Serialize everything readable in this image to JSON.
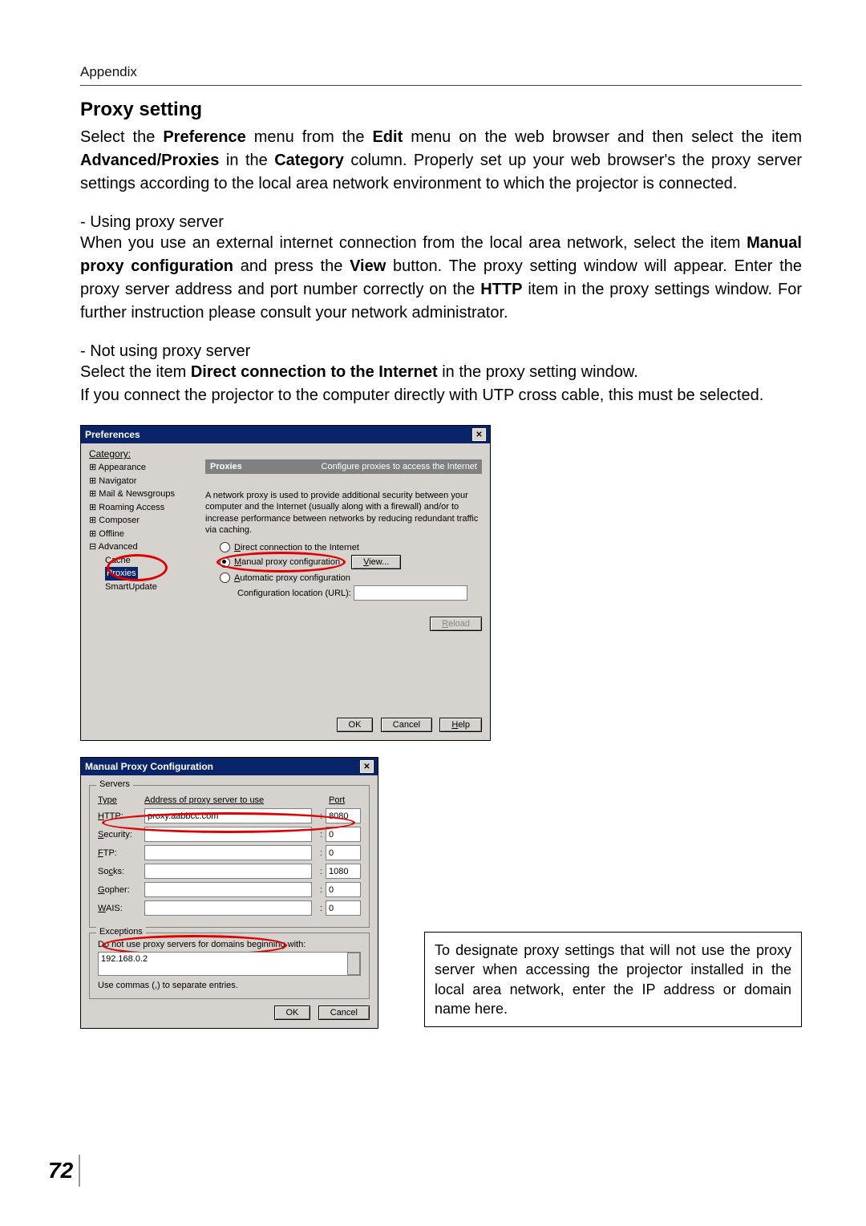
{
  "header": "Appendix",
  "title": "Proxy setting",
  "para1": {
    "pre": "Select the ",
    "bold1": "Preference",
    "mid1": " menu from the ",
    "bold2": "Edit",
    "mid2": " menu on the web browser and then select the item ",
    "bold3": "Advanced/Proxies",
    "mid3": " in the ",
    "bold4": "Category",
    "post": " column. Properly set up your web browser's the proxy server settings according to the local area network environment to which the projector is connected."
  },
  "sub1": "- Using proxy server",
  "para2": {
    "pre": "When you use an external internet connection from the local area network, select the item ",
    "bold1": "Manual proxy configuration",
    "mid1": " and press the ",
    "bold2": "View",
    "mid2": " button. The proxy setting window will appear. Enter the proxy server address and port number correctly on the ",
    "bold3": "HTTP",
    "post": " item in the proxy settings window. For further instruction please consult your network administrator."
  },
  "sub2": "- Not using proxy server",
  "para3": {
    "pre": "Select the item ",
    "bold1": "Direct connection to the Internet",
    "post": " in the proxy setting window."
  },
  "para4": "If you connect the projector to the computer directly with UTP cross cable, this must be selected.",
  "prefs": {
    "title": "Preferences",
    "category_label": "Category:",
    "tree": {
      "appearance": "Appearance",
      "navigator": "Navigator",
      "mail": "Mail & Newsgroups",
      "roaming": "Roaming Access",
      "composer": "Composer",
      "offline": "Offline",
      "advanced": "Advanced",
      "cache": "Cache",
      "proxies": "Proxies",
      "smart": "SmartUpdate"
    },
    "pane_title_left": "Proxies",
    "pane_title_right": "Configure proxies to access the Internet",
    "desc": "A network proxy is used to provide additional security between your computer and the Internet (usually along with a firewall) and/or to increase performance between networks by reducing redundant traffic via caching.",
    "radio_direct": "Direct connection to the Internet",
    "radio_manual": "Manual proxy configuration",
    "btn_view": "View...",
    "radio_auto": "Automatic proxy configuration",
    "url_label": "Configuration location (URL):",
    "btn_reload": "Reload",
    "btn_ok": "OK",
    "btn_cancel": "Cancel",
    "btn_help": "Help"
  },
  "manual": {
    "title": "Manual Proxy Configuration",
    "servers_label": "Servers",
    "type_label": "Type",
    "addr_label": "Address of proxy server to use",
    "port_label": "Port",
    "rows": [
      {
        "label": "HTTP:",
        "addr": "proxy.aabbcc.com",
        "port": "8080"
      },
      {
        "label": "Security:",
        "addr": "",
        "port": "0"
      },
      {
        "label": "FTP:",
        "addr": "",
        "port": "0"
      },
      {
        "label": "Socks:",
        "addr": "",
        "port": "1080"
      },
      {
        "label": "Gopher:",
        "addr": "",
        "port": "0"
      },
      {
        "label": "WAIS:",
        "addr": "",
        "port": "0"
      }
    ],
    "exceptions_label": "Exceptions",
    "exceptions_desc": "Do not use proxy servers for domains beginning with:",
    "exceptions_value": "192.168.0.2",
    "exceptions_hint": "Use commas (,) to separate entries.",
    "btn_ok": "OK",
    "btn_cancel": "Cancel"
  },
  "note": "To designate proxy settings that will not use the proxy server when accessing the projector installed in the local area network, enter the IP address or domain name here.",
  "page_number": "72"
}
